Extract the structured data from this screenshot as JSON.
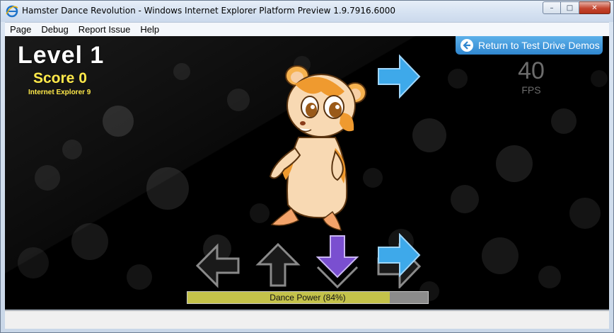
{
  "window": {
    "title": "Hamster Dance Revolution - Windows Internet Explorer Platform Preview 1.9.7916.6000",
    "minimize_glyph": "–",
    "maximize_glyph": "□",
    "close_glyph": "✕"
  },
  "menu": {
    "items": [
      "Page",
      "Debug",
      "Report Issue",
      "Help"
    ]
  },
  "game": {
    "level": "Level 1",
    "score": "Score 0",
    "browser": "Internet Explorer 9",
    "return_label": "Return to Test Drive Demos",
    "fps_value": "40",
    "fps_label": "FPS",
    "dance_power_label": "Dance Power (84%)",
    "dance_power_percent": 84,
    "prompt_arrow_direction": "right",
    "target_arrows": [
      "left",
      "up",
      "down",
      "right"
    ],
    "highlighted_arrow": "down"
  },
  "colors": {
    "accent_blue": "#3b95dc",
    "score_yellow": "#ffe94a",
    "power_fill": "#c4c24a",
    "down_arrow_purple": "#7a4fd0"
  },
  "icons": {
    "title_icon": "ie-icon",
    "return_icon": "back-arrow-icon",
    "character": "hamster-image"
  }
}
